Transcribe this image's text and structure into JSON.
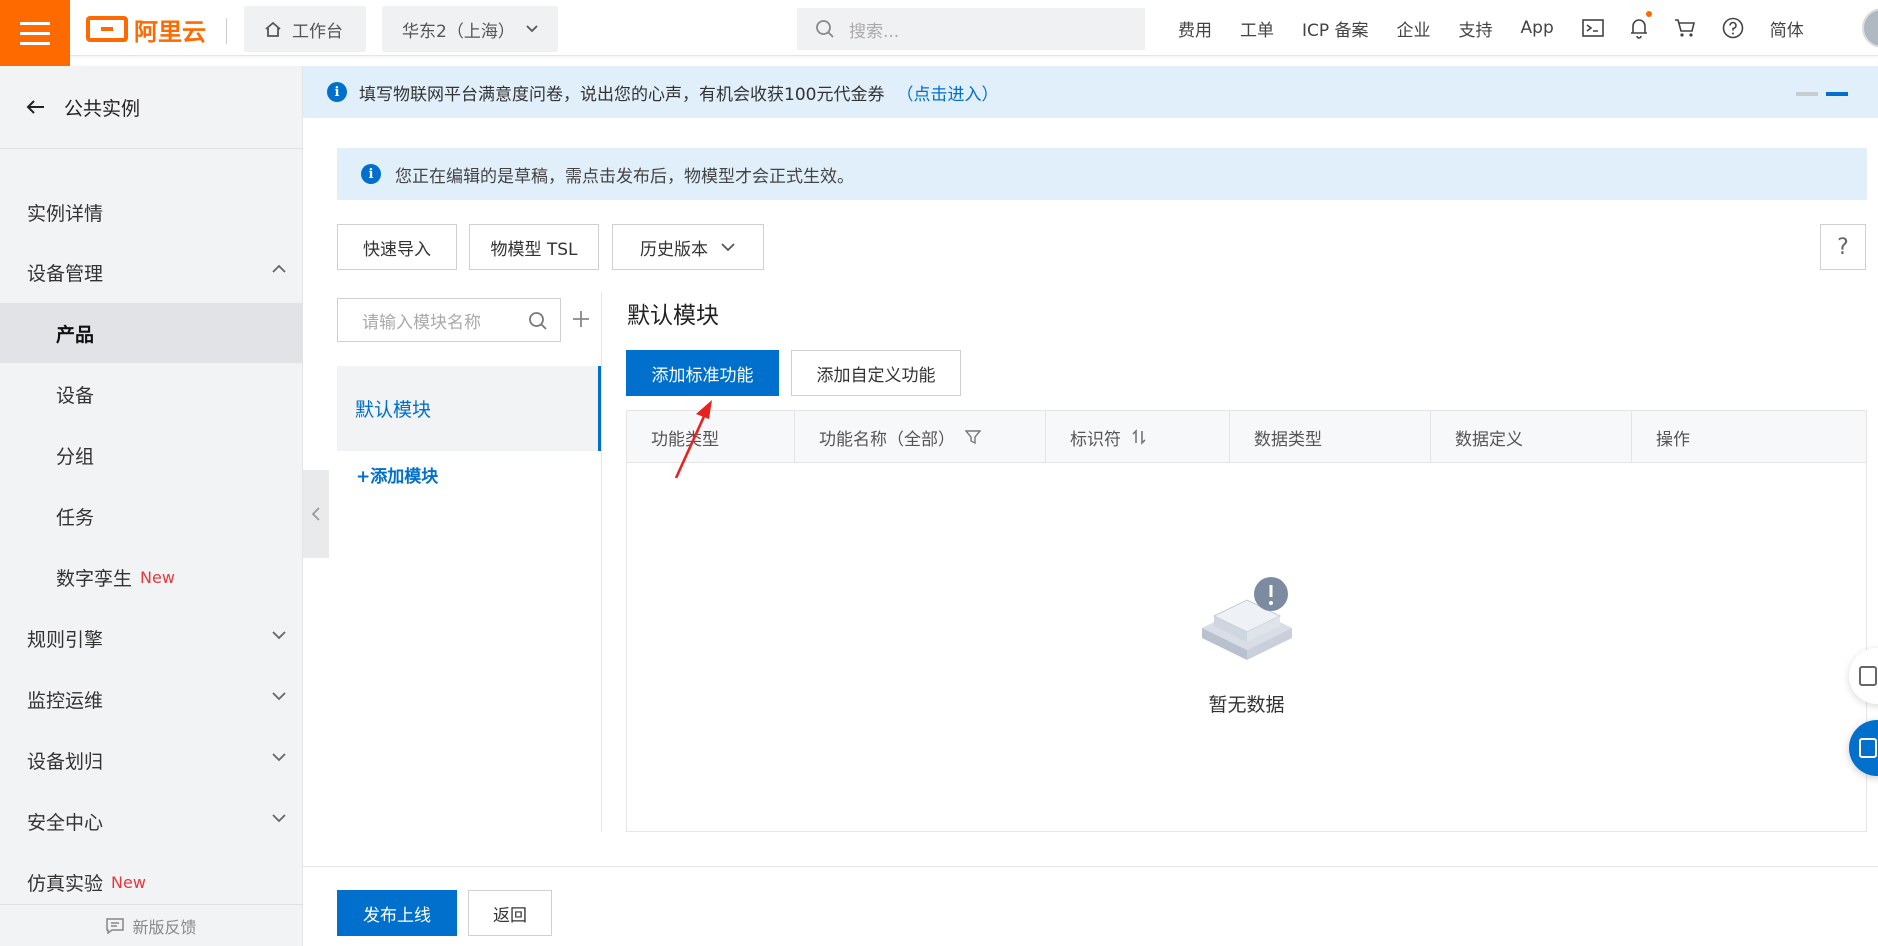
{
  "header": {
    "logo_text": "阿里云",
    "workbench_label": "工作台",
    "region_label": "华东2（上海）",
    "search_placeholder": "搜索...",
    "nav": [
      "费用",
      "工单",
      "ICP 备案",
      "企业",
      "支持",
      "App"
    ],
    "lang_label": "简体",
    "icons": [
      "terminal-icon",
      "bell-icon",
      "cart-icon",
      "help-circle-icon"
    ]
  },
  "sidebar": {
    "title": "公共实例",
    "items": [
      {
        "label": "实例详情",
        "level": 1
      },
      {
        "label": "设备管理",
        "level": 1,
        "expanded": true
      },
      {
        "label": "产品",
        "level": 2,
        "active": true
      },
      {
        "label": "设备",
        "level": 2
      },
      {
        "label": "分组",
        "level": 2
      },
      {
        "label": "任务",
        "level": 2
      },
      {
        "label": "数字孪生",
        "level": 2,
        "badge": "New"
      },
      {
        "label": "规则引擎",
        "level": 1
      },
      {
        "label": "监控运维",
        "level": 1
      },
      {
        "label": "设备划归",
        "level": 1
      },
      {
        "label": "安全中心",
        "level": 1
      },
      {
        "label": "仿真实验",
        "level": 1,
        "badge": "New"
      }
    ],
    "feedback_label": "新版反馈"
  },
  "banner": {
    "text": "填写物联网平台满意度问卷，说出您的心声，有机会收获100元代金券",
    "link_text": "（点击进入）"
  },
  "draft_notice": "您正在编辑的是草稿，需点击发布后，物模型才会正式生效。",
  "toolbar": {
    "quick_import": "快速导入",
    "tsl": "物模型 TSL",
    "history": "历史版本",
    "help": "?"
  },
  "modules": {
    "search_placeholder": "请输入模块名称",
    "items": [
      "默认模块"
    ],
    "add_label": "+添加模块"
  },
  "panel": {
    "title": "默认模块",
    "add_standard": "添加标准功能",
    "add_custom": "添加自定义功能",
    "columns": [
      "功能类型",
      "功能名称（全部）",
      "标识符",
      "数据类型",
      "数据定义",
      "操作"
    ],
    "empty_text": "暂无数据"
  },
  "footer": {
    "publish": "发布上线",
    "back": "返回"
  },
  "colors": {
    "brand_orange": "#ff6a00",
    "primary_blue": "#0070cc",
    "badge_red": "#e4393c",
    "annotation_red": "#e8231f"
  }
}
